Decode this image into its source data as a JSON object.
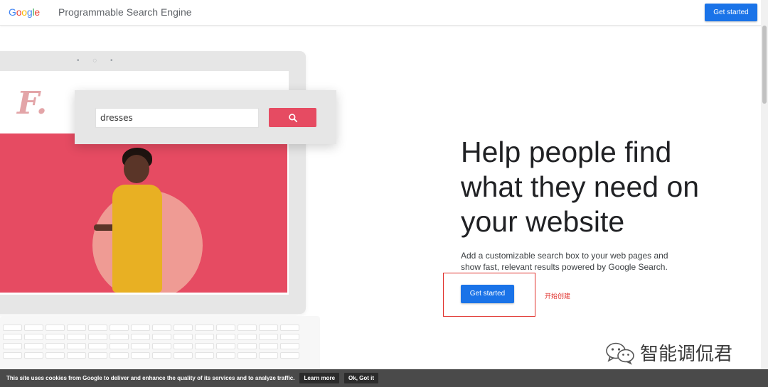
{
  "header": {
    "logo_letters": [
      {
        "char": "G",
        "color": "#4285F4"
      },
      {
        "char": "o",
        "color": "#EA4335"
      },
      {
        "char": "o",
        "color": "#FBBC05"
      },
      {
        "char": "g",
        "color": "#4285F4"
      },
      {
        "char": "l",
        "color": "#34A853"
      },
      {
        "char": "e",
        "color": "#EA4335"
      }
    ],
    "product_name": "Programmable Search Engine",
    "cta_label": "Get started"
  },
  "illustration": {
    "brand_mark": "F.",
    "search_value": "dresses",
    "search_icon": "search-icon"
  },
  "hero": {
    "headline": "Help people find what they need on your website",
    "subtext": "Add a customizable search box to your web pages and show fast, relevant results powered by Google Search.",
    "cta_label": "Get started",
    "annotation": "开始创建"
  },
  "watermark": {
    "text": "智能调侃君",
    "icon": "wechat-icon"
  },
  "cookie_bar": {
    "message": "This site uses cookies from Google to deliver and enhance the quality of its services and to analyze traffic.",
    "learn_more": "Learn more",
    "ok": "Ok, Got it"
  },
  "colors": {
    "accent": "#1a73e8",
    "brand_red": "#e64b62",
    "annotation_red": "#e0302b"
  }
}
